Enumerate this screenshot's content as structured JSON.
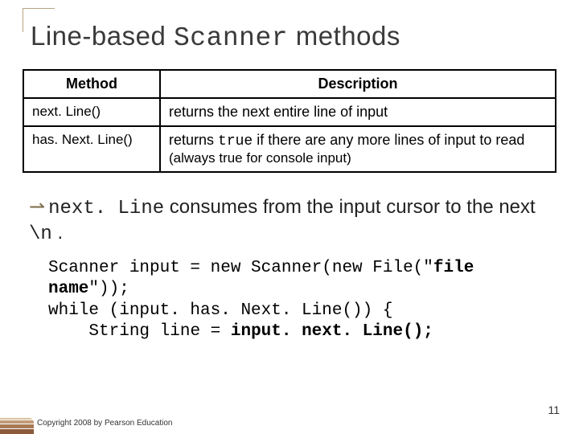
{
  "title": {
    "part1": "Line-based ",
    "mono": "Scanner",
    "part3": " methods"
  },
  "table": {
    "headers": {
      "method": "Method",
      "description": "Description"
    },
    "rows": [
      {
        "method": "next. Line()",
        "desc_prefix": "returns the next entire line of input",
        "desc_mono": "",
        "desc_suffix": "",
        "desc_paren": ""
      },
      {
        "method": "has. Next. Line()",
        "desc_prefix": "returns ",
        "desc_mono": "true",
        "desc_suffix": " if there are any more lines of input to read ",
        "desc_paren": "(always true for console input)"
      }
    ]
  },
  "body": {
    "bullet_glyph": "⇀",
    "prefix_mono": "next. Line",
    "text1": " consumes from the input cursor to the next ",
    "mono2": "\\n",
    "text2": " ."
  },
  "code": {
    "l1a": "Scanner input = new Scanner(new File(\"",
    "l1b": "file name",
    "l1c": "\"));",
    "l2": "while (input. has. Next. Line()) {",
    "l3a": "    String line = ",
    "l3b": "input. next. Line();"
  },
  "footer": "Copyright 2008 by Pearson Education",
  "page_number": "11"
}
